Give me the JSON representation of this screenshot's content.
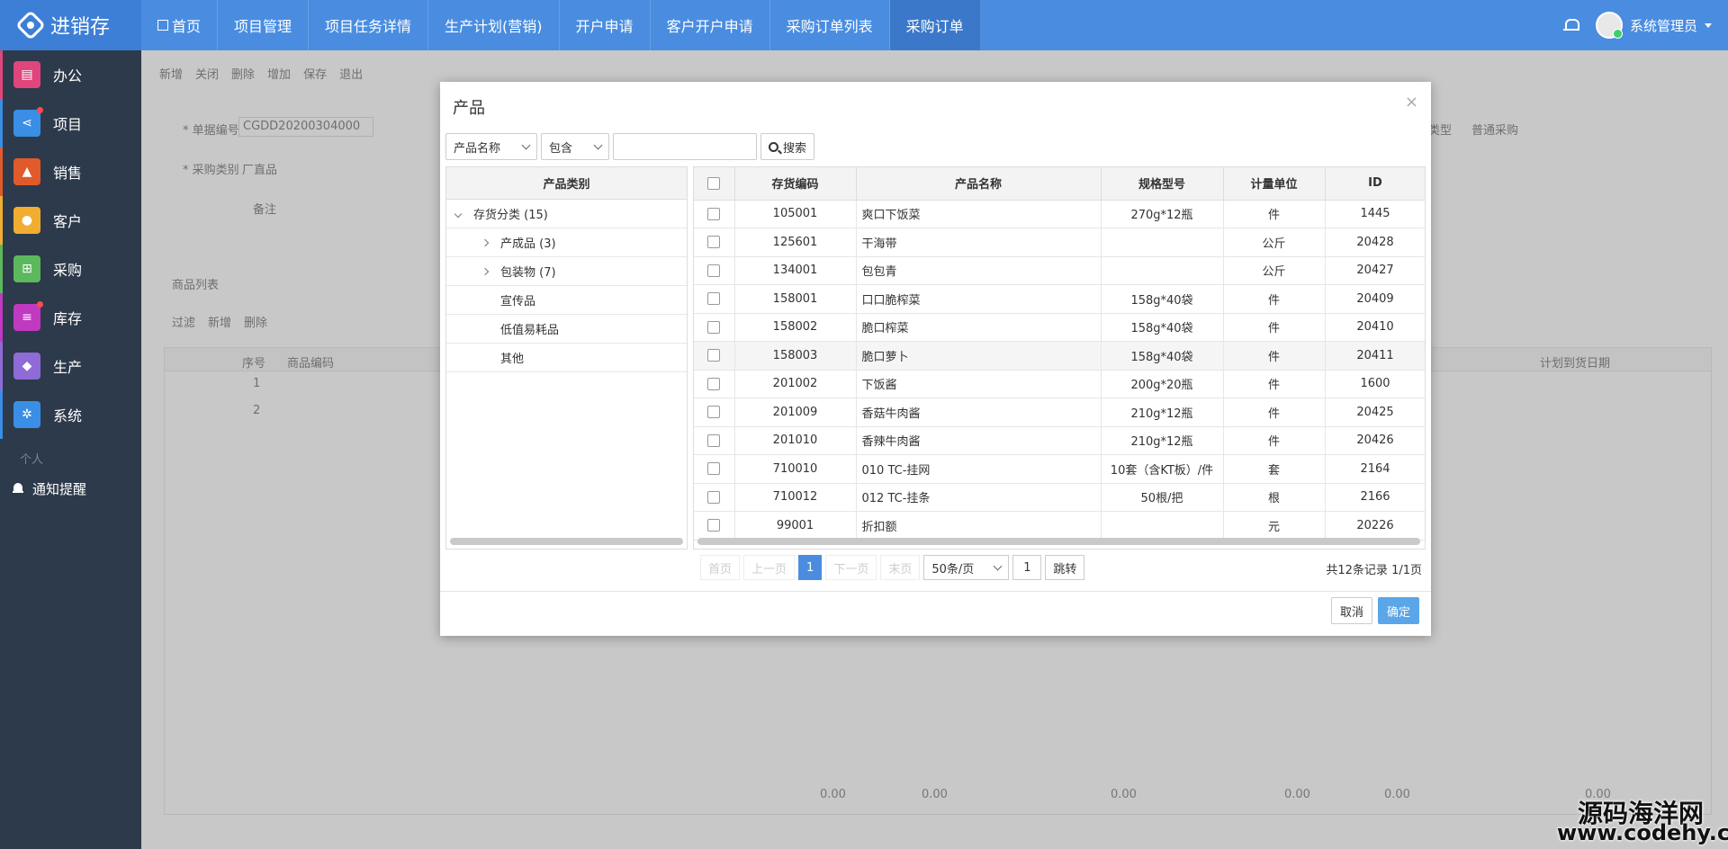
{
  "app": {
    "title": "进销存"
  },
  "nav": {
    "items": [
      {
        "label": "首页"
      },
      {
        "label": "项目管理"
      },
      {
        "label": "项目任务详情"
      },
      {
        "label": "生产计划(营销)"
      },
      {
        "label": "开户申请"
      },
      {
        "label": "客户开户申请"
      },
      {
        "label": "采购订单列表"
      },
      {
        "label": "采购订单",
        "active": true
      }
    ]
  },
  "user": {
    "name": "系统管理员"
  },
  "sidebar": {
    "items": [
      {
        "label": "办公",
        "icon": "document-icon",
        "color": "#e0457b"
      },
      {
        "label": "项目",
        "icon": "share-icon",
        "color": "#3a8ee6"
      },
      {
        "label": "销售",
        "icon": "road-icon",
        "color": "#e05a2b"
      },
      {
        "label": "客户",
        "icon": "users-icon",
        "color": "#f0ad30"
      },
      {
        "label": "采购",
        "icon": "cart-icon",
        "color": "#5cb85c"
      },
      {
        "label": "库存",
        "icon": "database-icon",
        "color": "#c039c0"
      },
      {
        "label": "生产",
        "icon": "cube-icon",
        "color": "#8e6bd6"
      },
      {
        "label": "系统",
        "icon": "gears-icon",
        "color": "#3a8ee6"
      }
    ],
    "section": "个人",
    "notice": "通知提醒"
  },
  "background": {
    "toolbar": [
      "新增",
      "关闭",
      "删除",
      "增加",
      "保存",
      "退出"
    ],
    "doc_no_label": "* 单据编号",
    "doc_no_value": "CGDD20200304000",
    "purchase_type_label": "* 采购类别",
    "purchase_type_value": "厂直品",
    "remark_label": "备注",
    "purchase_kind_label": "类型",
    "purchase_kind_value": "普通采购",
    "list_title": "商品列表",
    "list_actions": [
      "过滤",
      "新增",
      "删除"
    ],
    "grid_headers": [
      "序号",
      "商品编码",
      "计划到货日期"
    ],
    "rows": [
      "1",
      "2"
    ],
    "zeros": [
      "0.00",
      "0.00",
      "0.00",
      "0.00",
      "0.00",
      "0.00"
    ]
  },
  "modal": {
    "title": "产品",
    "filter_field": "产品名称",
    "filter_op": "包含",
    "search_placeholder": "",
    "search_button": "搜索",
    "tree": {
      "header": "产品类别",
      "items": [
        {
          "label": "存货分类 (15)",
          "level": 0,
          "arrow": "down"
        },
        {
          "label": "产成品 (3)",
          "level": 1,
          "arrow": "right"
        },
        {
          "label": "包装物 (7)",
          "level": 1,
          "arrow": "right"
        },
        {
          "label": "宣传品",
          "level": 1,
          "arrow": "none"
        },
        {
          "label": "低值易耗品",
          "level": 1,
          "arrow": "none"
        },
        {
          "label": "其他",
          "level": 1,
          "arrow": "none"
        }
      ]
    },
    "table": {
      "columns": [
        "存货编码",
        "产品名称",
        "规格型号",
        "计量单位",
        "ID"
      ],
      "rows": [
        {
          "code": "105001",
          "name": "爽口下饭菜",
          "spec": "270g*12瓶",
          "unit": "件",
          "id": "1445"
        },
        {
          "code": "125601",
          "name": "干海带",
          "spec": "",
          "unit": "公斤",
          "id": "20428"
        },
        {
          "code": "134001",
          "name": "包包青",
          "spec": "",
          "unit": "公斤",
          "id": "20427"
        },
        {
          "code": "158001",
          "name": "口口脆榨菜",
          "spec": "158g*40袋",
          "unit": "件",
          "id": "20409"
        },
        {
          "code": "158002",
          "name": "脆口榨菜",
          "spec": "158g*40袋",
          "unit": "件",
          "id": "20410"
        },
        {
          "code": "158003",
          "name": "脆口萝卜",
          "spec": "158g*40袋",
          "unit": "件",
          "id": "20411"
        },
        {
          "code": "201002",
          "name": "下饭酱",
          "spec": "200g*20瓶",
          "unit": "件",
          "id": "1600"
        },
        {
          "code": "201009",
          "name": "香菇牛肉酱",
          "spec": "210g*12瓶",
          "unit": "件",
          "id": "20425"
        },
        {
          "code": "201010",
          "name": "香辣牛肉酱",
          "spec": "210g*12瓶",
          "unit": "件",
          "id": "20426"
        },
        {
          "code": "710010",
          "name": "010 TC-挂网",
          "spec": "10套（含KT板）/件",
          "unit": "套",
          "id": "2164"
        },
        {
          "code": "710012",
          "name": "012 TC-挂条",
          "spec": "50根/把",
          "unit": "根",
          "id": "2166"
        },
        {
          "code": "99001",
          "name": "折扣额",
          "spec": "",
          "unit": "元",
          "id": "20226"
        }
      ]
    },
    "pager": {
      "first": "首页",
      "prev": "上一页",
      "current": "1",
      "next": "下一页",
      "last": "末页",
      "page_size": "50条/页",
      "jump_value": "1",
      "jump": "跳转",
      "summary": "共12条记录 1/1页"
    },
    "cancel": "取消",
    "confirm": "确定"
  },
  "watermark": {
    "line1": "源码海洋网",
    "line2": "www.codehy.com"
  }
}
